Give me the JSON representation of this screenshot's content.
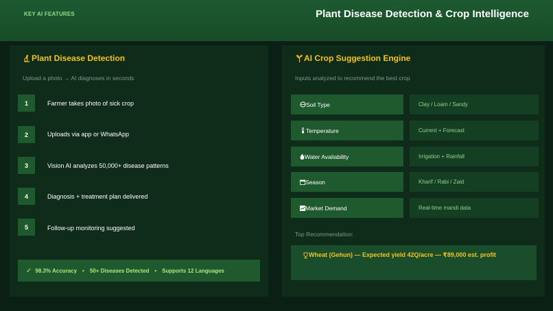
{
  "header": {
    "kicker": "KEY AI FEATURES",
    "title": "Plant Disease Detection & Crop Intelligence"
  },
  "left_panel": {
    "title": "Plant Disease Detection",
    "subtitle": "Upload a photo → AI diagnoses in seconds",
    "steps": [
      {
        "num": "1",
        "text": "Farmer takes photo of sick crop"
      },
      {
        "num": "2",
        "text": "Uploads via app or WhatsApp"
      },
      {
        "num": "3",
        "text": "Vision AI analyzes 50,000+ disease patterns"
      },
      {
        "num": "4",
        "text": "Diagnosis + treatment plan delivered"
      },
      {
        "num": "5",
        "text": "Follow-up monitoring suggested"
      }
    ],
    "stats": {
      "check": "✓",
      "accuracy": "98.3% Accuracy",
      "diseases": "50+ Diseases Detected",
      "languages": "Supports 12 Languages",
      "separator": "•"
    }
  },
  "right_panel": {
    "title": "AI Crop Suggestion Engine",
    "subtitle": "Inputs analyzed to recommend the best crop",
    "inputs": [
      {
        "label": "Soil Type",
        "value": "Clay / Loam / Sandy"
      },
      {
        "label": "Temperature",
        "value": "Current + Forecast"
      },
      {
        "label": "Water Availability",
        "value": "Irrigation + Rainfall"
      },
      {
        "label": "Season",
        "value": "Kharif / Rabi / Zaid"
      },
      {
        "label": "Market Demand",
        "value": "Real-time mandi data"
      }
    ],
    "recommendation_label": "Top Recommendation:",
    "recommendation": "Wheat (Gehun) — Expected yield 42Q/acre — ₹89,000 est. profit"
  },
  "icons": {
    "left_title": "microscope-icon",
    "right_title": "seedling-icon",
    "soil": "soil-icon",
    "temperature": "thermometer-icon",
    "water": "water-drop-icon",
    "season": "calendar-icon",
    "market": "chart-icon",
    "recommendation": "trophy-icon"
  },
  "colors": {
    "background": "#0b2014",
    "header": "#1d5a30",
    "panel": "#0f2b1a",
    "accent_gold": "#f3c417",
    "accent_green": "#a8e97f"
  }
}
